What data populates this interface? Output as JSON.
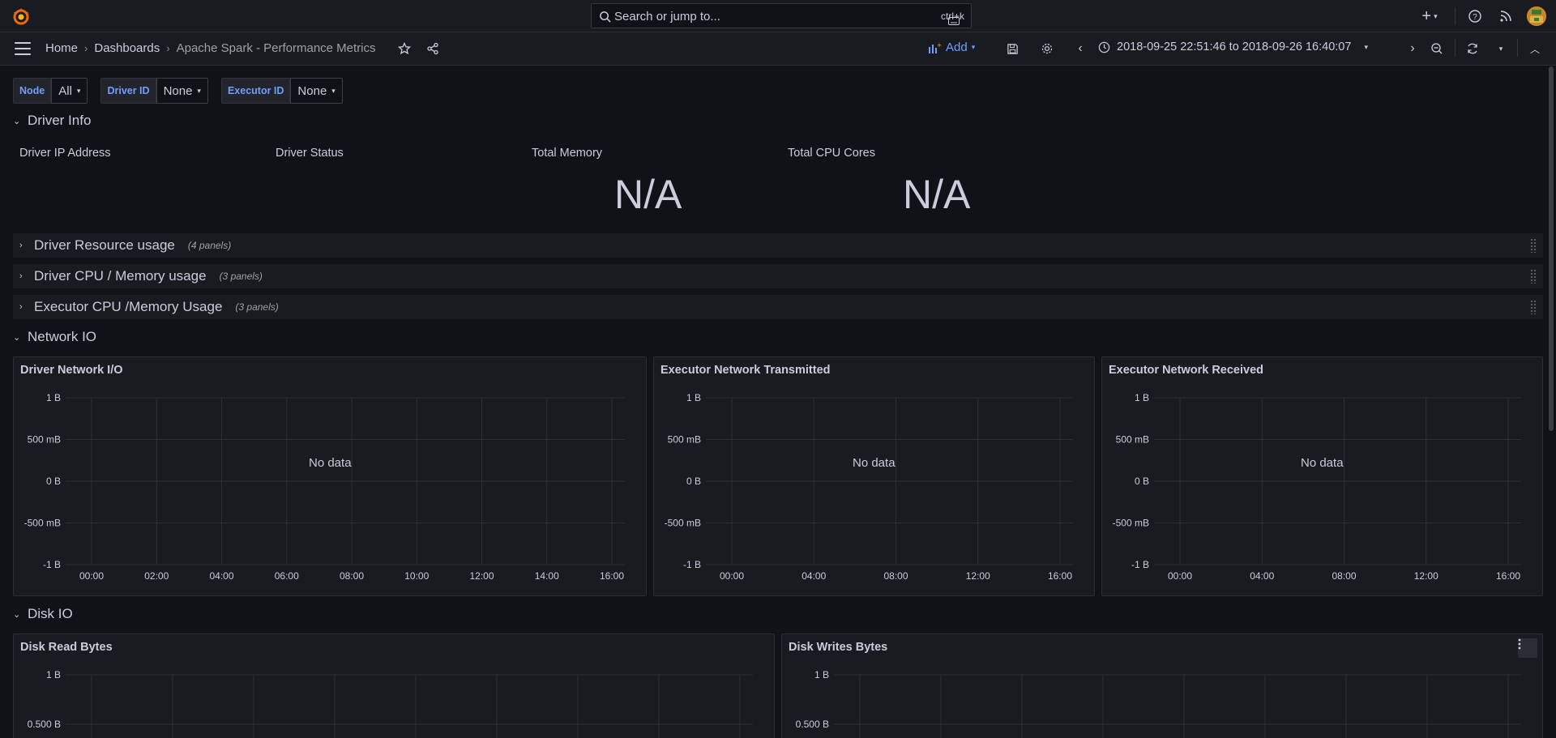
{
  "topbar": {
    "search_placeholder": "Search or jump to...",
    "search_shortcut": "ctrl+k",
    "icons": [
      "grafana-logo",
      "search-icon",
      "keyboard-icon",
      "plus-icon",
      "chevron-down-icon",
      "help-icon",
      "rss-icon",
      "avatar"
    ]
  },
  "navbar": {
    "breadcrumbs": [
      "Home",
      "Dashboards",
      "Apache Spark - Performance Metrics"
    ],
    "add_label": "Add",
    "time_range": "2018-09-25 22:51:46 to 2018-09-26 16:40:07"
  },
  "variables": [
    {
      "label": "Node",
      "value": "All"
    },
    {
      "label": "Driver ID",
      "value": "None"
    },
    {
      "label": "Executor ID",
      "value": "None"
    }
  ],
  "rows": {
    "driver_info": {
      "title": "Driver Info"
    },
    "driver_resource": {
      "title": "Driver Resource usage",
      "count": "(4 panels)"
    },
    "driver_cpu_mem": {
      "title": "Driver CPU / Memory usage",
      "count": "(3 panels)"
    },
    "executor_cpu_mem": {
      "title": "Executor CPU /Memory Usage",
      "count": "(3 panels)"
    },
    "network_io": {
      "title": "Network IO"
    },
    "disk_io": {
      "title": "Disk IO"
    }
  },
  "stats": [
    {
      "title": "Driver IP Address",
      "value": ""
    },
    {
      "title": "Driver Status",
      "value": ""
    },
    {
      "title": "Total Memory",
      "value": "N/A"
    },
    {
      "title": "Total CPU Cores",
      "value": "N/A"
    }
  ],
  "panels": {
    "driver_net": {
      "title": "Driver Network I/O",
      "nodata": "No data",
      "yticks": [
        "1 B",
        "500 mB",
        "0 B",
        "-500 mB",
        "-1 B"
      ],
      "xticks": [
        "00:00",
        "02:00",
        "04:00",
        "06:00",
        "08:00",
        "10:00",
        "12:00",
        "14:00",
        "16:00"
      ]
    },
    "exec_tx": {
      "title": "Executor Network Transmitted",
      "nodata": "No data",
      "yticks": [
        "1 B",
        "500 mB",
        "0 B",
        "-500 mB",
        "-1 B"
      ],
      "xticks": [
        "00:00",
        "04:00",
        "08:00",
        "12:00",
        "16:00"
      ]
    },
    "exec_rx": {
      "title": "Executor Network Received",
      "nodata": "No data",
      "yticks": [
        "1 B",
        "500 mB",
        "0 B",
        "-500 mB",
        "-1 B"
      ],
      "xticks": [
        "00:00",
        "04:00",
        "08:00",
        "12:00",
        "16:00"
      ]
    },
    "disk_read": {
      "title": "Disk Read Bytes",
      "yticks": [
        "1 B",
        "0.500 B"
      ]
    },
    "disk_write": {
      "title": "Disk Writes Bytes",
      "yticks": [
        "1 B",
        "0.500 B"
      ]
    }
  },
  "chart_data": [
    {
      "type": "line",
      "title": "Driver Network I/O",
      "series": [],
      "x": [
        "00:00",
        "02:00",
        "04:00",
        "06:00",
        "08:00",
        "10:00",
        "12:00",
        "14:00",
        "16:00"
      ],
      "ylim": [
        "-1 B",
        "1 B"
      ],
      "grid": true
    },
    {
      "type": "line",
      "title": "Executor Network Transmitted",
      "series": [],
      "x": [
        "00:00",
        "04:00",
        "08:00",
        "12:00",
        "16:00"
      ],
      "ylim": [
        "-1 B",
        "1 B"
      ],
      "grid": true
    },
    {
      "type": "line",
      "title": "Executor Network Received",
      "series": [],
      "x": [
        "00:00",
        "04:00",
        "08:00",
        "12:00",
        "16:00"
      ],
      "ylim": [
        "-1 B",
        "1 B"
      ],
      "grid": true
    },
    {
      "type": "line",
      "title": "Disk Read Bytes",
      "series": [],
      "grid": true
    },
    {
      "type": "line",
      "title": "Disk Writes Bytes",
      "series": [],
      "grid": true
    }
  ],
  "colors": {
    "accent": "#6e9fff",
    "background": "#111217",
    "panel": "#181b1f"
  }
}
